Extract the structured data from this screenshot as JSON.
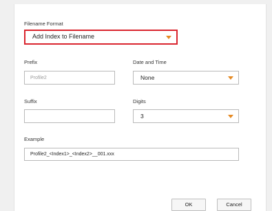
{
  "filename_format": {
    "label": "Filename Format",
    "selected": "Add Index to Filename"
  },
  "prefix": {
    "label": "Prefix",
    "placeholder": "Profile2"
  },
  "date_time": {
    "label": "Date and Time",
    "selected": "None"
  },
  "suffix": {
    "label": "Suffix",
    "value": ""
  },
  "digits": {
    "label": "Digits",
    "selected": "3"
  },
  "example": {
    "label": "Example",
    "value": "Profile2_<Index1>_<Index2>__001.xxx"
  },
  "buttons": {
    "ok": "OK",
    "cancel": "Cancel"
  },
  "colors": {
    "accent_caret": "#e58a24",
    "highlight_border": "#d9232d"
  }
}
